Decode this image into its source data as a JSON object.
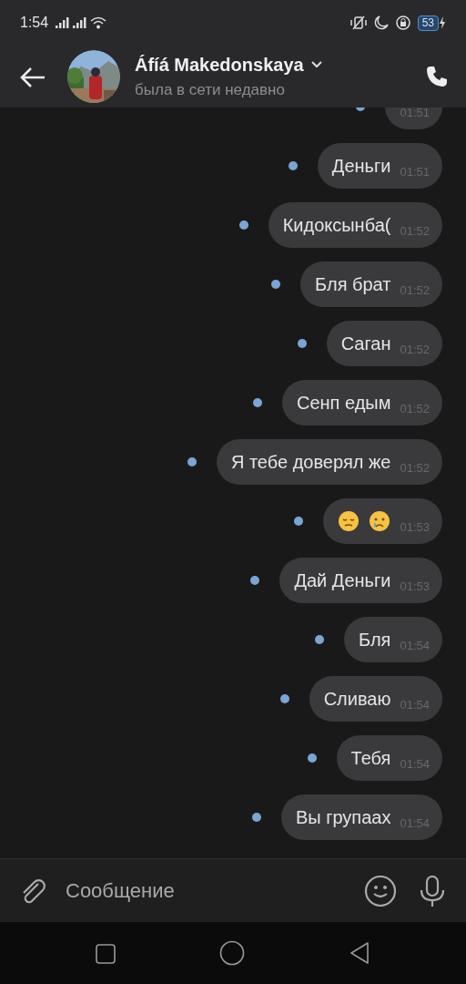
{
  "status_bar": {
    "time": "1:54",
    "battery": "53"
  },
  "header": {
    "name": "Áfíá Makedonskaya",
    "status": "была в сети недавно"
  },
  "messages": [
    {
      "kind": "text",
      "time": "01:51",
      "unread": true
    },
    {
      "kind": "text",
      "text": "Деньги",
      "time": "01:51",
      "unread": true
    },
    {
      "kind": "text",
      "text": "Кидоксынба(",
      "time": "01:52",
      "unread": true
    },
    {
      "kind": "text",
      "text": "Бля брат",
      "time": "01:52",
      "unread": true
    },
    {
      "kind": "text",
      "text": "Саган",
      "time": "01:52",
      "unread": true
    },
    {
      "kind": "text",
      "text": "Сенп едым",
      "time": "01:52",
      "unread": true
    },
    {
      "kind": "text",
      "text": "Я тебе доверял же",
      "time": "01:52",
      "unread": true
    },
    {
      "kind": "emoji",
      "time": "01:53",
      "unread": true
    },
    {
      "kind": "text",
      "text": "Дай Деньги",
      "time": "01:53",
      "unread": true
    },
    {
      "kind": "text",
      "text": "Бля",
      "time": "01:54",
      "unread": true
    },
    {
      "kind": "text",
      "text": "Сливаю",
      "time": "01:54",
      "unread": true
    },
    {
      "kind": "text",
      "text": "Тебя",
      "time": "01:54",
      "unread": true
    },
    {
      "kind": "text",
      "text": "Вы групаах",
      "time": "01:54",
      "unread": true
    }
  ],
  "composer": {
    "placeholder": "Сообщение"
  }
}
